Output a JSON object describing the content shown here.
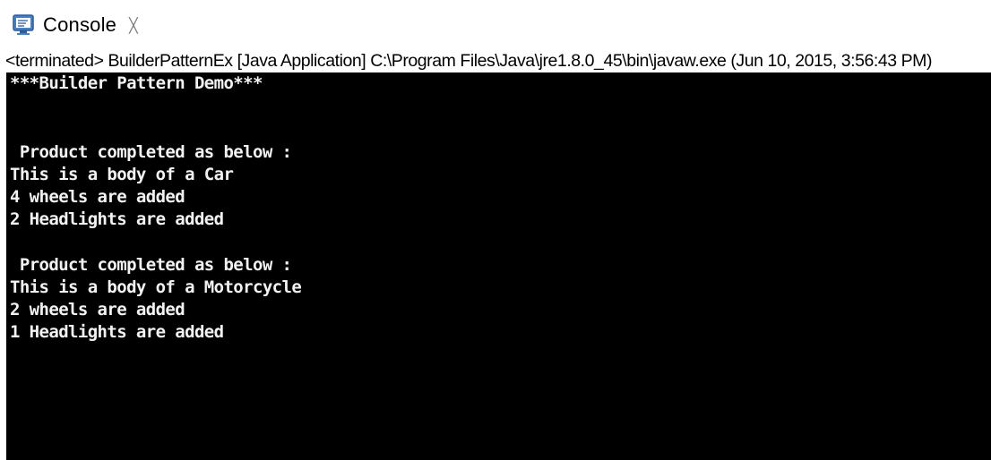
{
  "tab": {
    "icon": "console-icon",
    "label": "Console",
    "close_icon": "close-icon",
    "close_glyph": "╳"
  },
  "status": {
    "text": "<terminated> BuilderPatternEx [Java Application] C:\\Program Files\\Java\\jre1.8.0_45\\bin\\javaw.exe (Jun 10, 2015, 3:56:43 PM)"
  },
  "console": {
    "background": "#000000",
    "text_color": "#f2f2f2",
    "lines": [
      "***Builder Pattern Demo***",
      "",
      "",
      " Product completed as below :",
      "This is a body of a Car",
      "4 wheels are added",
      "2 Headlights are added",
      "",
      " Product completed as below :",
      "This is a body of a Motorcycle",
      "2 wheels are added",
      "1 Headlights are added"
    ]
  }
}
